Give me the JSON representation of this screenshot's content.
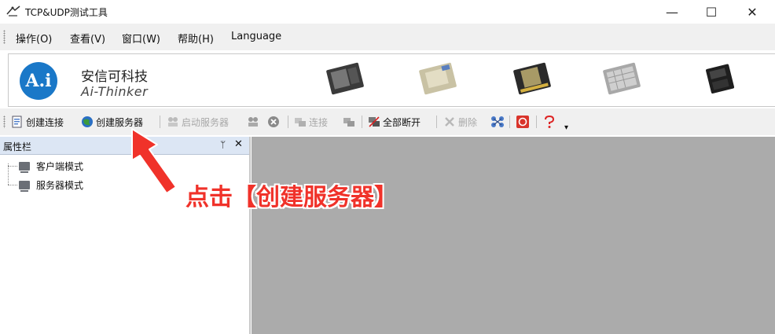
{
  "window": {
    "title": "TCP&UDP测试工具",
    "controls": {
      "minimize": "—",
      "maximize": "☐",
      "close": "✕"
    }
  },
  "menu": {
    "items": [
      "操作(O)",
      "查看(V)",
      "窗口(W)",
      "帮助(H)",
      "Language"
    ]
  },
  "banner": {
    "logo_text": "A.i",
    "company_cn": "安信可科技",
    "company_en": "Ai-Thinker",
    "module_count": 5
  },
  "toolbar": {
    "create_connection": "创建连接",
    "create_server": "创建服务器",
    "start_server": "启动服务器",
    "connect": "连接",
    "disconnect_all": "全部断开",
    "delete": "删除",
    "overflow": "▾"
  },
  "panel": {
    "title": "属性栏",
    "pin": "ᛘ",
    "close": "✕",
    "tree": [
      "客户端模式",
      "服务器模式"
    ]
  },
  "annotation": {
    "text": "点击【创建服务器】",
    "color": "#f0322a"
  },
  "colors": {
    "brand_blue": "#1a78c8",
    "workspace_gray": "#ababab",
    "panel_header": "#dce6f4"
  }
}
